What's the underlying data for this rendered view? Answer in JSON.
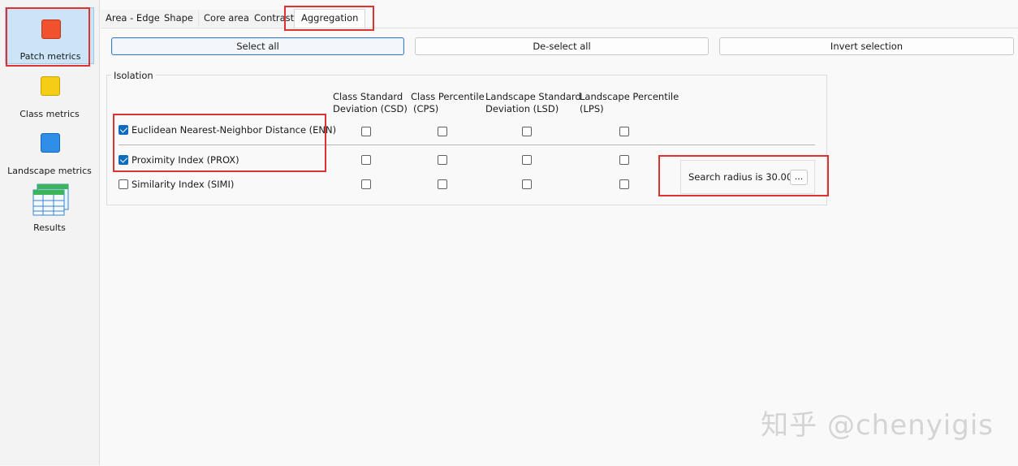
{
  "nav": {
    "items": [
      {
        "label": "Patch metrics",
        "icon": "red-square-icon",
        "color": "#f0522e",
        "selected": true
      },
      {
        "label": "Class metrics",
        "icon": "yellow-square-icon",
        "color": "#f5cc16",
        "selected": false
      },
      {
        "label": "Landscape metrics",
        "icon": "blue-square-icon",
        "color": "#2f8ee8",
        "selected": false
      },
      {
        "label": "Results",
        "icon": "table-grid-icon",
        "color": "#2aa84a",
        "selected": false
      }
    ]
  },
  "tabs": [
    {
      "label": "Area - Edge",
      "active": false
    },
    {
      "label": "Shape",
      "active": false
    },
    {
      "label": "Core area",
      "active": false
    },
    {
      "label": "Contrast",
      "active": false
    },
    {
      "label": "Aggregation",
      "active": true
    }
  ],
  "toolbar": {
    "select_all": "Select all",
    "deselect_all": "De-select all",
    "invert_selection": "Invert selection"
  },
  "group": {
    "title": "Isolation",
    "columns": [
      {
        "line1": "Class Standard",
        "line2": "Deviation  (CSD)"
      },
      {
        "line1": "Class Percentile",
        "line2": "(CPS)"
      },
      {
        "line1": "Landscape Standard",
        "line2": "Deviation  (LSD)"
      },
      {
        "line1": "Landscape Percentile",
        "line2": "(LPS)"
      }
    ],
    "rows": [
      {
        "label": "Euclidean Nearest-Neighbor Distance (ENN)",
        "checked": true,
        "cols": [
          false,
          false,
          false,
          false
        ]
      },
      {
        "label": "Proximity Index  (PROX)",
        "checked": true,
        "cols": [
          false,
          false,
          false,
          false
        ]
      },
      {
        "label": "Similarity Index  (SIMI)",
        "checked": false,
        "cols": [
          false,
          false,
          false,
          false
        ]
      }
    ]
  },
  "search_radius": {
    "text": "Search radius is 30.00.",
    "button": "..."
  },
  "watermark": "知乎 @chenyigis",
  "highlight_color": "#e03131",
  "accent_color": "#0f6cbd"
}
